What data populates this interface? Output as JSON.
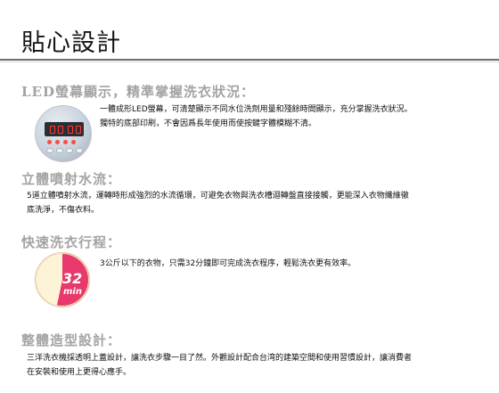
{
  "page": {
    "title": "貼心設計"
  },
  "sections": [
    {
      "heading": "LED螢幕顯示，精準掌握洗衣狀況：",
      "image_icon": "led-display-panel-icon",
      "lines": [
        "一體成形LED螢幕，可清楚顯示不同水位洗劑用量和殘餘時間顯示，充分掌握洗衣狀況。",
        "獨特的底部印刷，不會因爲長年使用而使按鍵字體模糊不清。"
      ]
    },
    {
      "heading": "立體噴射水流：",
      "lines": [
        "5道立體噴射水流，運轉時形成強烈的水流循環，可避免衣物與洗衣槽迴轉盤直接接觸，更能深入衣物纖維徹",
        "底洗淨，不傷衣料。"
      ]
    },
    {
      "heading": "快速洗衣行程：",
      "image_icon": "32-min-dial-icon",
      "dial_number": "32",
      "dial_unit": "min",
      "dial_fraction": 0.533,
      "lines": [
        "3公斤以下的衣物，只需32分鐘即可完成洗衣程序，輕鬆洗衣更有效率。"
      ]
    },
    {
      "heading": "整體造型設計：",
      "lines": [
        "三洋洗衣機採透明上蓋設計，讓洗衣步驟一目了然。外觀設計配合台湾的建築空間和使用習慣設計，讓消費者",
        "在安裝和使用上更得心應手。"
      ]
    }
  ],
  "colors": {
    "heading": "#a3a3a3",
    "rule": "#6e6e6e",
    "dial_pink": "#e8386c",
    "dial_cream": "#fdf3d6",
    "led_red": "#ff3b2e"
  }
}
